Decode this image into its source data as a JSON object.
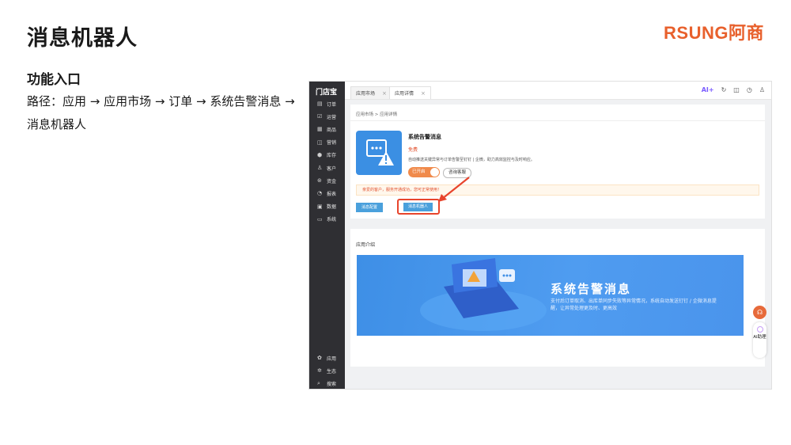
{
  "slide": {
    "title": "消息机器人",
    "logo": "RSUNG阿商",
    "section_title": "功能入口",
    "path_text": "路径：应用 → 应用市场 → 订单 → 系统告警消息 → 消息机器人"
  },
  "app": {
    "brand": "门店宝",
    "nav": [
      {
        "label": "订单",
        "icon": "order-icon",
        "glyph": "▤"
      },
      {
        "label": "运营",
        "icon": "operation-icon",
        "glyph": "☑"
      },
      {
        "label": "商品",
        "icon": "product-icon",
        "glyph": "▦"
      },
      {
        "label": "营销",
        "icon": "marketing-icon",
        "glyph": "◫"
      },
      {
        "label": "库存",
        "icon": "inventory-icon",
        "glyph": "⬢"
      },
      {
        "label": "客户",
        "icon": "customer-icon",
        "glyph": "♙"
      },
      {
        "label": "资金",
        "icon": "funds-icon",
        "glyph": "⊛"
      },
      {
        "label": "报表",
        "icon": "report-icon",
        "glyph": "◔"
      },
      {
        "label": "数据",
        "icon": "data-icon",
        "glyph": "▣"
      },
      {
        "label": "系统",
        "icon": "system-icon",
        "glyph": "▭"
      }
    ],
    "nav_bottom": [
      {
        "label": "应用",
        "icon": "apps-icon",
        "glyph": "✿"
      },
      {
        "label": "生态",
        "icon": "ecosystem-icon",
        "glyph": "✲"
      },
      {
        "label": "搜索",
        "icon": "search-icon",
        "glyph": "⌕"
      }
    ],
    "tabs": [
      {
        "label": "应用市场"
      },
      {
        "label": "应用详情"
      }
    ],
    "top_icons": {
      "ai": "AI+"
    },
    "breadcrumb": "应用市场 > 应用详情",
    "app_name": "系统告警消息",
    "price": "免费",
    "description": "自动推送关键异常与订单告警至钉钉 | 企微，助力高效监控与及时响应。",
    "toggle_label": "已开启",
    "consult_label": "咨询客服",
    "notice": "亲爱的客户，服务开通成功，您可正常使用！",
    "basic_config_label": "消息配置",
    "robot_label": "消息机器人",
    "intro_title": "应用介绍",
    "banner": {
      "title": "系统告警消息",
      "desc": "支付后订单取消、出库单同步失败等异常情况，系统自动发送钉钉 / 企微消息提醒，让异常处理更及时、更高效"
    },
    "ai_assistant": "AI助理",
    "colors": {
      "accent": "#e8602c",
      "primary_blue": "#4aa0dc",
      "highlight_red": "#e8442c"
    }
  }
}
